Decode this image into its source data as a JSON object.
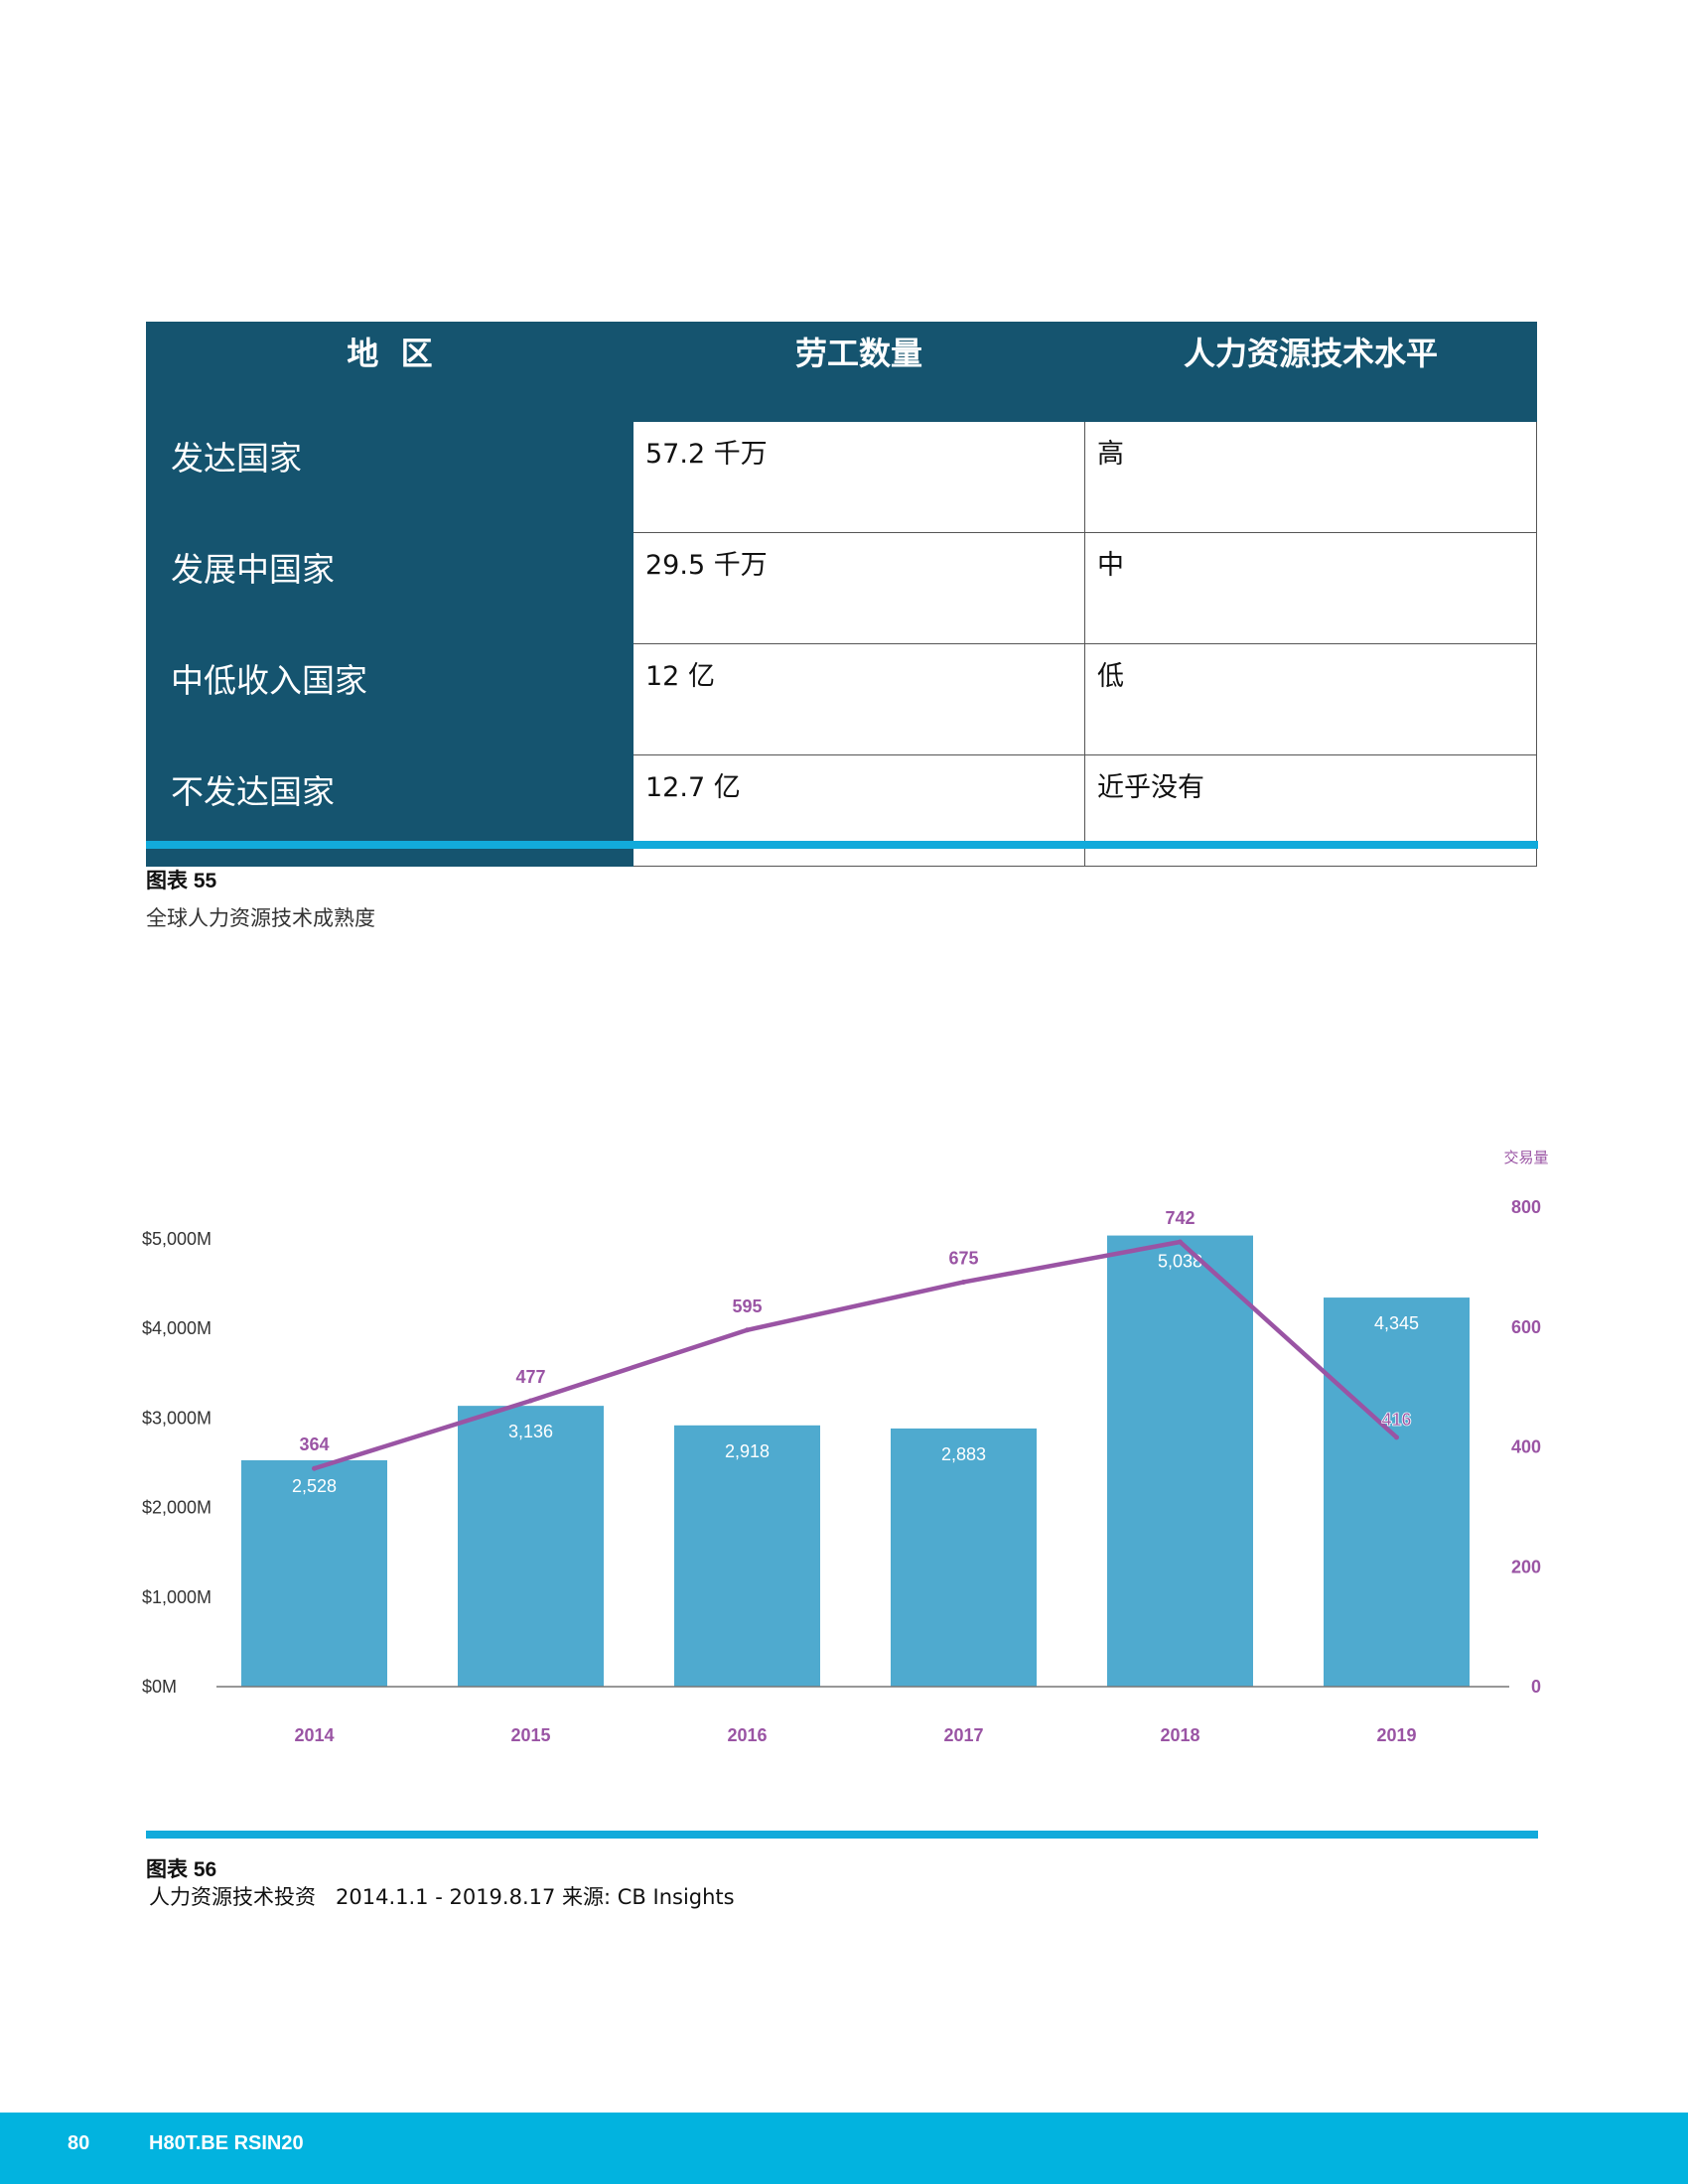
{
  "table": {
    "headers": [
      "地  区",
      "劳工数量",
      "人力资源技术水平"
    ],
    "rows": [
      {
        "region": "发达国家",
        "workers": "57.2 千万",
        "level": "高"
      },
      {
        "region": "发展中国家",
        "workers": "29.5 千万",
        "level": "中"
      },
      {
        "region": "中低收入国家",
        "workers": "12 亿",
        "level": "低"
      },
      {
        "region": "不发达国家",
        "workers": "12.7 亿",
        "level": "近乎没有"
      }
    ]
  },
  "figure55": {
    "label": "图表 55",
    "subtitle": "全球人力资源技术成熟度"
  },
  "figure56": {
    "label": "图表 56",
    "subtitle": "人力资源技术投资   2014.1.1 - 2019.8.17 来源: CB Insights"
  },
  "chart_data": {
    "type": "bar",
    "categories": [
      "2014",
      "2015",
      "2016",
      "2017",
      "2018",
      "2019"
    ],
    "series": [
      {
        "type": "bar",
        "values": [
          2528,
          3136,
          2918,
          2883,
          5038,
          4345
        ],
        "labels": [
          "2,528",
          "3,136",
          "2,918",
          "2,883",
          "5,038",
          "4,345"
        ],
        "color": "#4faacf"
      },
      {
        "type": "line",
        "axis": "right",
        "values": [
          364,
          477,
          595,
          675,
          742,
          416
        ],
        "color": "#9a54a4"
      }
    ],
    "left_axis": {
      "ticks": [
        "$0M",
        "$1,000M",
        "$2,000M",
        "$3,000M",
        "$4,000M",
        "$5,000M"
      ],
      "ylim": [
        0,
        5000
      ]
    },
    "right_axis": {
      "title": "交易量",
      "ticks": [
        "0",
        "200",
        "400",
        "600",
        "800"
      ],
      "ylim": [
        0,
        800
      ]
    },
    "grid": false
  },
  "footer": {
    "page": "80",
    "brand": "H80T.BE RSIN20",
    "color": "#02b3df"
  }
}
